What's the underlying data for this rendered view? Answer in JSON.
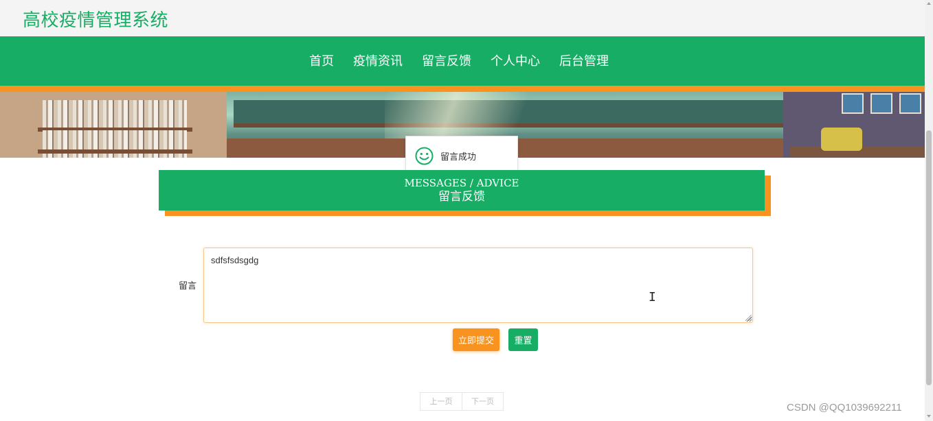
{
  "header": {
    "site_title": "高校疫情管理系统"
  },
  "nav": {
    "items": [
      {
        "label": "首页"
      },
      {
        "label": "疫情资讯"
      },
      {
        "label": "留言反馈"
      },
      {
        "label": "个人中心"
      },
      {
        "label": "后台管理"
      }
    ]
  },
  "toast": {
    "message": "留言成功",
    "icon": "smiley-icon"
  },
  "section": {
    "title_en": "MESSAGES / ADVICE",
    "title_cn": "留言反馈"
  },
  "form": {
    "label": "留言",
    "textarea_value": "sdfsfsdsgdg",
    "submit_label": "立即提交",
    "reset_label": "重置"
  },
  "pagination": {
    "prev_label": "上一页",
    "next_label": "下一页"
  },
  "watermark": "CSDN @QQ1039692211",
  "colors": {
    "primary_green": "#18ad65",
    "accent_orange": "#f7931e"
  }
}
